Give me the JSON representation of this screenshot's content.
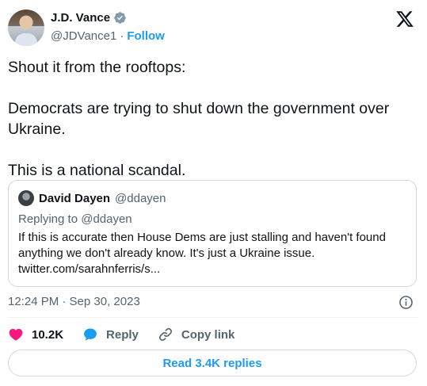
{
  "author": {
    "display_name": "J.D. Vance",
    "handle": "@JDVance1",
    "separator": "·",
    "follow_label": "Follow"
  },
  "tweet": {
    "paragraphs": [
      "Shout it from the rooftops:",
      "Democrats are trying to shut down the government over Ukraine.",
      "This is a national scandal."
    ]
  },
  "quoted_tweet": {
    "display_name": "David Dayen",
    "handle": "@ddayen",
    "replying_to": "Replying to @ddayen",
    "body": "If this is accurate then House Dems are just stalling and haven't found anything we don't already know. It's just a Ukraine issue. twitter.com/sarahnferris/s..."
  },
  "meta": {
    "timestamp": "12:24 PM · Sep 30, 2023"
  },
  "actions": {
    "like_count": "10.2K",
    "reply_label": "Reply",
    "copy_link_label": "Copy link"
  },
  "footer": {
    "read_replies_label": "Read 3.4K replies"
  },
  "icons": {
    "verified": "verified-badge-icon",
    "logo": "x-logo-icon",
    "info": "info-icon",
    "like": "heart-icon",
    "reply": "speech-bubble-icon",
    "link": "link-icon"
  },
  "colors": {
    "accent": "#1d9bf0",
    "like": "#f91880",
    "text": "#0f1419",
    "muted": "#536471"
  }
}
